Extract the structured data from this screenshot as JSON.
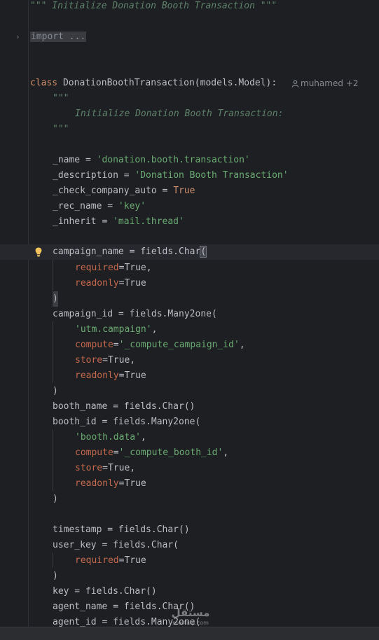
{
  "author": {
    "label": "muhamed +2"
  },
  "watermark": {
    "label": "مستقل",
    "domain": "mostaql.com"
  },
  "lines": {
    "doc1": "\"\"\" Initialize Donation Booth Transaction \"\"\"",
    "import": "import ...",
    "class_kw": "class",
    "class_rest": " DonationBoothTransaction(models.Model):",
    "doc_open": "\"\"\"",
    "doc_text": "Initialize Donation Booth Transaction:",
    "doc_close": "\"\"\"",
    "name_a": "_name = ",
    "name_b": "'donation.booth.transaction'",
    "desc_a": "_description = ",
    "desc_b": "'Donation Booth Transaction'",
    "cca_a": "_check_company_auto = ",
    "cca_b": "True",
    "rec_a": "_rec_name = ",
    "rec_b": "'key'",
    "inh_a": "_inherit = ",
    "inh_b": "'mail.thread'",
    "cn_a": "campaign_name = fields.Char",
    "cn_b": "(",
    "req1_a": "required",
    "req1_b": "=True,",
    "ro1_a": "readonly",
    "ro1_b": "=True",
    "close1": ")",
    "cid": "campaign_id = fields.Many2one(",
    "utm": "'utm.campaign'",
    "comma": ",",
    "comp1_a": "compute",
    "comp1_b": "=",
    "comp1_c": "'_compute_campaign_id'",
    "store1_a": "store",
    "store1_b": "=True,",
    "ro2_a": "readonly",
    "ro2_b": "=True",
    "close2": ")",
    "bname": "booth_name = fields.Char()",
    "bid": "booth_id = fields.Many2one(",
    "bdata": "'booth.data'",
    "comp2_a": "compute",
    "comp2_b": "=",
    "comp2_c": "'_compute_booth_id'",
    "store2_a": "store",
    "store2_b": "=True,",
    "ro3_a": "readonly",
    "ro3_b": "=True",
    "close3": ")",
    "ts": "timestamp = fields.Char()",
    "ukey": "user_key = fields.Char(",
    "req2_a": "required",
    "req2_b": "=True",
    "close4": ")",
    "key": "key = fields.Char()",
    "aname": "agent_name = fields.Char()",
    "aid": "agent_id = fields.Many2one("
  }
}
